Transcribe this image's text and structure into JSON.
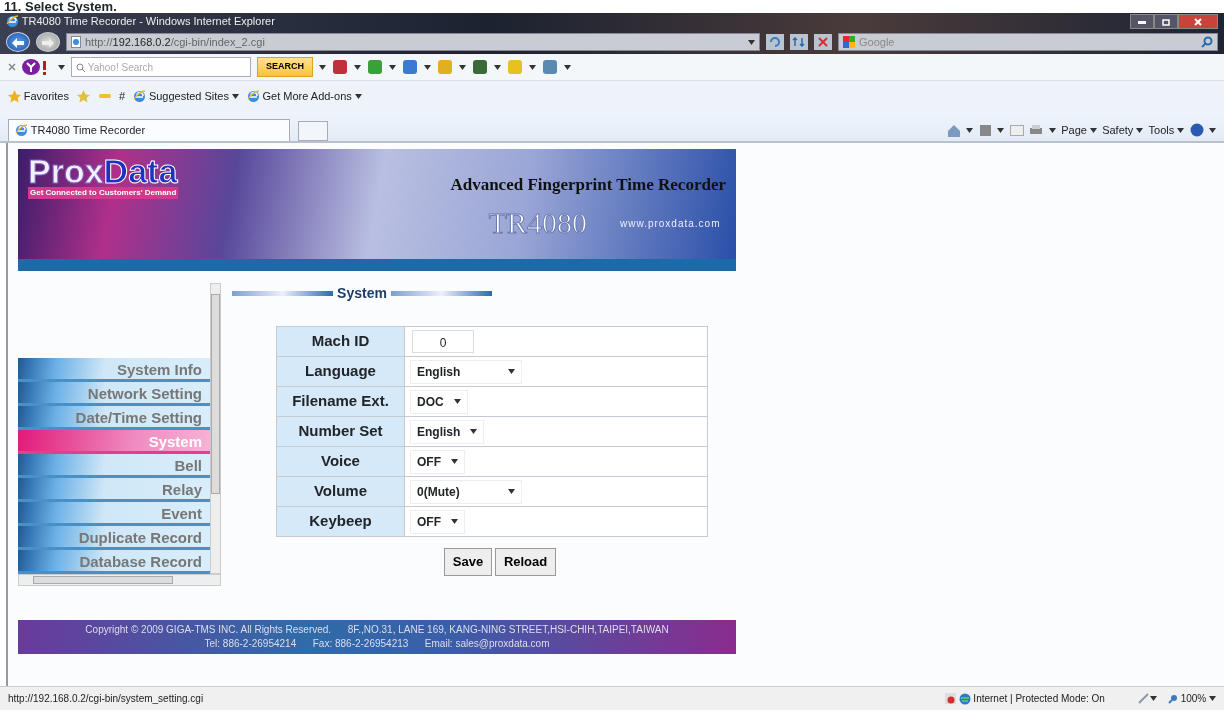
{
  "heading": "11. Select System.",
  "window": {
    "title": "TR4080 Time Recorder - Windows Internet Explorer"
  },
  "address_bar": {
    "url_prefix": "http://",
    "url_host": "192.168.0.2",
    "url_path": "/cgi-bin/index_2.cgi"
  },
  "search_box": {
    "placeholder": "Google"
  },
  "yahoo_toolbar": {
    "search_placeholder": "Yahoo! Search",
    "search_button": "SEARCH"
  },
  "favorites_bar": {
    "favorites": "Favorites",
    "hash": "#",
    "links": [
      {
        "label": "Suggested Sites"
      },
      {
        "label": "Get More Add-ons"
      }
    ]
  },
  "tabs": [
    {
      "label": "TR4080 Time Recorder",
      "selected": true
    }
  ],
  "command_bar": [
    "Page",
    "Safety",
    "Tools"
  ],
  "banner": {
    "logo_outline": "Prox",
    "logo_solid": "Data",
    "tagline": "Get Connected to Customers' Demand",
    "title": "Advanced Fingerprint Time Recorder",
    "model": "TR4080",
    "website": "www.proxdata.com"
  },
  "sidebar": {
    "items": [
      {
        "label": "System Info",
        "selected": false
      },
      {
        "label": "Network Setting",
        "selected": false
      },
      {
        "label": "Date/Time Setting",
        "selected": false
      },
      {
        "label": "System",
        "selected": true
      },
      {
        "label": "Bell",
        "selected": false
      },
      {
        "label": "Relay",
        "selected": false
      },
      {
        "label": "Event",
        "selected": false
      },
      {
        "label": "Duplicate Record",
        "selected": false
      },
      {
        "label": "Database Record",
        "selected": false
      }
    ]
  },
  "section_title": "System",
  "fields": [
    {
      "label": "Mach ID",
      "kind": "text",
      "value": "0"
    },
    {
      "label": "Language",
      "kind": "select",
      "value": "English"
    },
    {
      "label": "Filename Ext.",
      "kind": "select",
      "value": "DOC"
    },
    {
      "label": "Number Set",
      "kind": "select",
      "value": "English"
    },
    {
      "label": "Voice",
      "kind": "select",
      "value": "OFF"
    },
    {
      "label": "Volume",
      "kind": "select",
      "value": "0(Mute)"
    },
    {
      "label": "Keybeep",
      "kind": "select",
      "value": "OFF"
    }
  ],
  "buttons": [
    "Save",
    "Reload"
  ],
  "footer": {
    "copyright": "Copyright © 2009 GIGA-TMS INC. All Rights Reserved.",
    "address": "8F.,NO.31, LANE 169, KANG-NING STREET,HSI-CHIH,TAIPEI,TAIWAN",
    "tel": "Tel: 886-2-26954214",
    "fax": "Fax: 886-2-26954213",
    "email_label": "Email:",
    "email": "sales@proxdata.com"
  },
  "status_bar": {
    "url": "http://192.168.0.2/cgi-bin/system_setting.cgi",
    "zone": "Internet | Protected Mode: On",
    "zoom": "100%"
  }
}
